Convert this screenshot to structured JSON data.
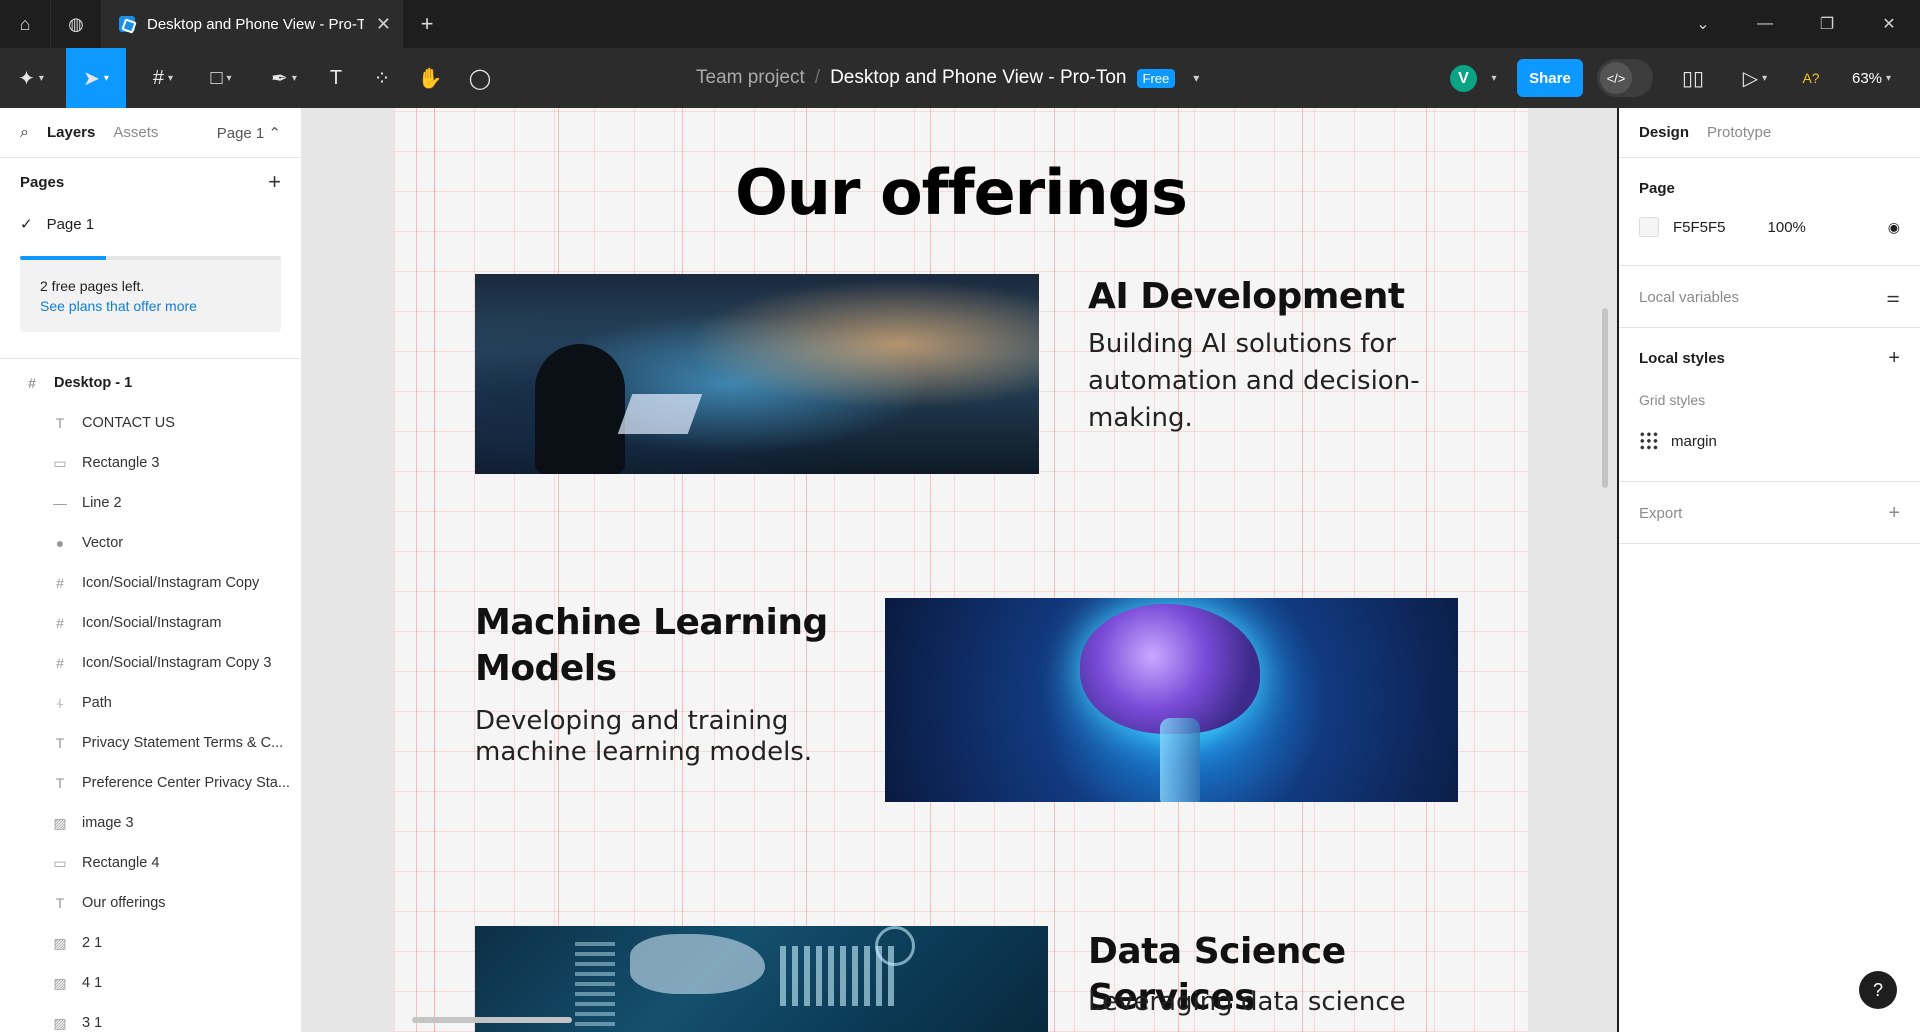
{
  "titlebar": {
    "tab_title": "Desktop and Phone View - Pro-Ton",
    "new_tab": "+",
    "close_tab": "✕"
  },
  "toolbar": {
    "team": "Team project",
    "separator": "/",
    "file_name": "Desktop and Phone View - Pro-Ton",
    "plan_badge": "Free",
    "avatar_initial": "V",
    "share_label": "Share",
    "dev_mode": "</>",
    "ai_label": "A?",
    "zoom": "63%"
  },
  "left_panel": {
    "tabs": {
      "layers": "Layers",
      "assets": "Assets",
      "page_selector": "Page 1 ⌃"
    },
    "pages_heading": "Pages",
    "pages": [
      {
        "label": "Page 1",
        "selected": true
      }
    ],
    "free_pages_progress": 0.33,
    "plan_notice": "2 free pages left.",
    "plan_link": "See plans that offer more",
    "layers": [
      {
        "label": "Desktop - 1",
        "icon": "frame-icon",
        "level": 0
      },
      {
        "label": "CONTACT US",
        "icon": "text-icon",
        "level": 1
      },
      {
        "label": "Rectangle 3",
        "icon": "rectangle-icon",
        "level": 1
      },
      {
        "label": "Line 2",
        "icon": "line-icon",
        "level": 1
      },
      {
        "label": "Vector",
        "icon": "vector-icon",
        "level": 1
      },
      {
        "label": "Icon/Social/Instagram Copy",
        "icon": "frame-icon",
        "level": 1
      },
      {
        "label": "Icon/Social/Instagram",
        "icon": "frame-icon",
        "level": 1
      },
      {
        "label": "Icon/Social/Instagram Copy 3",
        "icon": "frame-icon",
        "level": 1
      },
      {
        "label": "Path",
        "icon": "path-icon",
        "level": 1
      },
      {
        "label": "Privacy Statement Terms & C...",
        "icon": "text-icon",
        "level": 1
      },
      {
        "label": "Preference Center Privacy Sta...",
        "icon": "text-icon",
        "level": 1
      },
      {
        "label": "image 3",
        "icon": "image-icon",
        "level": 1
      },
      {
        "label": "Rectangle 4",
        "icon": "rectangle-icon",
        "level": 1
      },
      {
        "label": "Our offerings",
        "icon": "text-icon",
        "level": 1
      },
      {
        "label": "2 1",
        "icon": "image-icon",
        "level": 1
      },
      {
        "label": "4 1",
        "icon": "image-icon",
        "level": 1
      },
      {
        "label": "3 1",
        "icon": "image-icon",
        "level": 1
      }
    ]
  },
  "canvas": {
    "heading": "Our offerings",
    "services": [
      {
        "title": "AI Development",
        "description": "Building AI solutions for automation and decision-making."
      },
      {
        "title": "Machine Learning Models",
        "description": "Developing and training machine learning models."
      },
      {
        "title": "Data Science Services",
        "description": "Leveraging data science"
      }
    ]
  },
  "right_panel": {
    "tabs": {
      "design": "Design",
      "prototype": "Prototype"
    },
    "page_heading": "Page",
    "page_color": "F5F5F5",
    "page_opacity": "100%",
    "local_variables": "Local variables",
    "local_styles": "Local styles",
    "grid_styles": "Grid styles",
    "grid_style_name": "margin",
    "export": "Export"
  },
  "help_label": "?",
  "colors": {
    "accent": "#0d99ff",
    "toolbar_bg": "#2c2c2c",
    "canvas_bg": "#e6e6e6",
    "frame_bg": "#F5F5F5"
  }
}
